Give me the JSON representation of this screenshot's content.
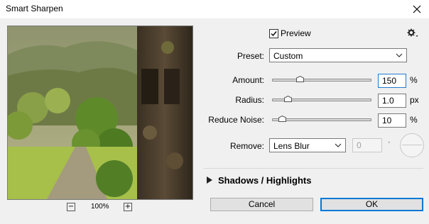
{
  "window": {
    "title": "Smart Sharpen"
  },
  "preview": {
    "zoom_level": "100%",
    "zoom_out": "−",
    "zoom_in": "+"
  },
  "options": {
    "preview_label": "Preview",
    "preview_checked": true
  },
  "preset": {
    "label": "Preset:",
    "value": "Custom"
  },
  "amount": {
    "label": "Amount:",
    "value": "150",
    "unit": "%",
    "slider_fraction": 0.28
  },
  "radius": {
    "label": "Radius:",
    "value": "1.0",
    "unit": "px",
    "slider_fraction": 0.16
  },
  "reduce_noise": {
    "label": "Reduce Noise:",
    "value": "10",
    "unit": "%",
    "slider_fraction": 0.1
  },
  "remove": {
    "label": "Remove:",
    "value": "Lens Blur",
    "angle": "0",
    "degree_symbol": "°"
  },
  "section": {
    "label": "Shadows / Highlights",
    "expanded": false
  },
  "buttons": {
    "cancel": "Cancel",
    "ok": "OK"
  },
  "icons": {
    "close": "close-icon",
    "gear": "gear-icon",
    "checkbox": "checkmark-icon",
    "chevron": "chevron-down-icon",
    "expand": "triangle-right-icon"
  },
  "colors": {
    "accent": "#0078d7",
    "focus": "#1e7bd0",
    "window_bg": "#f0f0f0"
  }
}
